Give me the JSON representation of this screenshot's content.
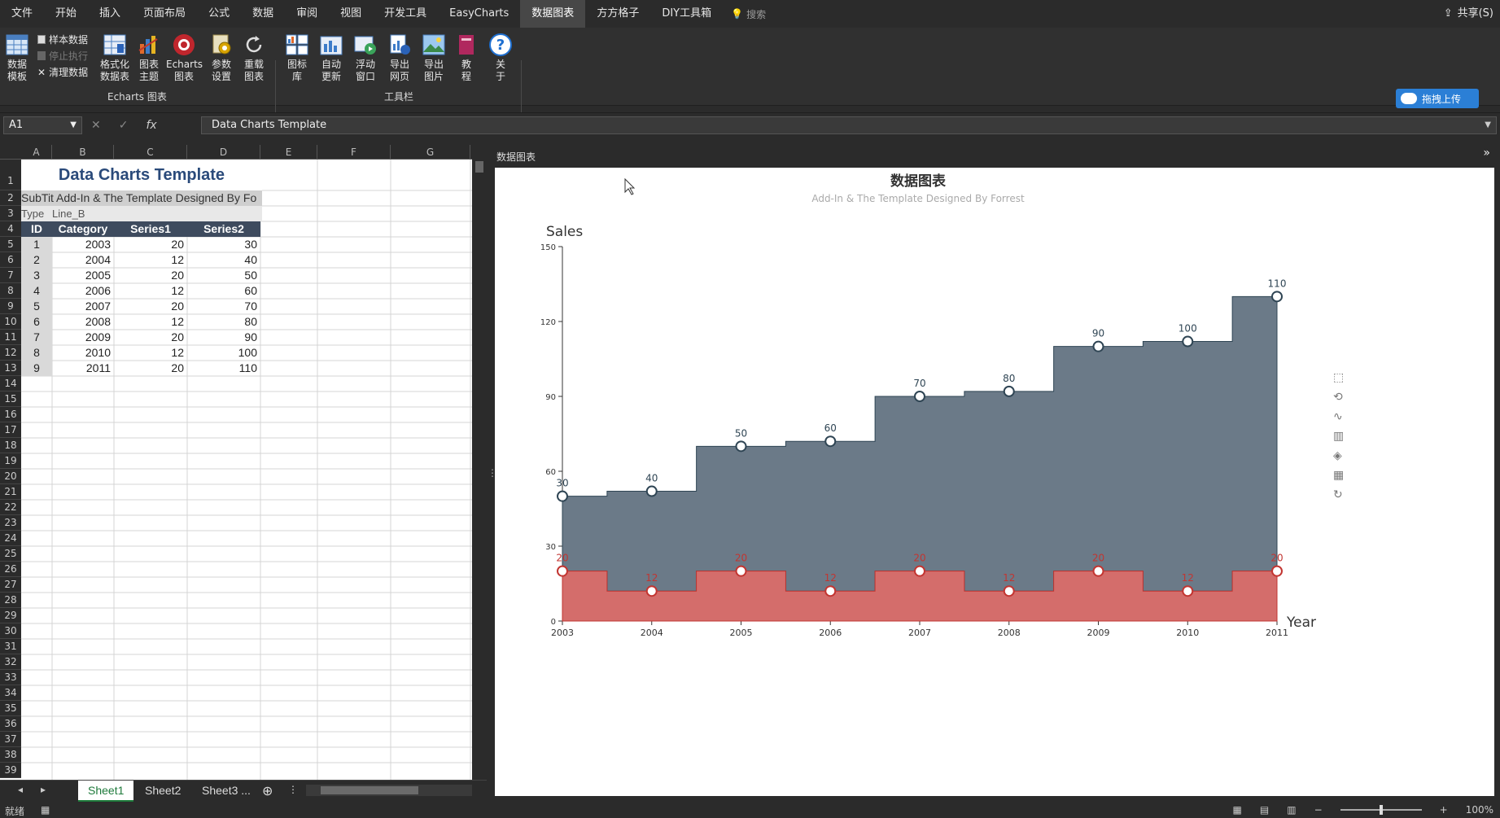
{
  "menu": {
    "items": [
      "文件",
      "开始",
      "插入",
      "页面布局",
      "公式",
      "数据",
      "审阅",
      "视图",
      "开发工具",
      "EasyCharts",
      "数据图表",
      "方方格子",
      "DIY工具箱"
    ],
    "active": "数据图表",
    "search_label": "搜索",
    "share_label": "共享(S)"
  },
  "ribbon": {
    "data_template": "数据模板",
    "sample_data": "样本数据",
    "stop_exec": "停止执行",
    "clear_data": "清理数据",
    "format_table": "格式化数据表",
    "chart_theme": "图表主题",
    "echarts_chart": "Echarts图表",
    "params": "参数设置",
    "reload": "重载图表",
    "group_echarts": "Echarts 图表",
    "gallery": "图标库",
    "auto_update": "自动更新",
    "float_window": "浮动窗口",
    "export_web": "导出网页",
    "export_img": "导出图片",
    "tutorial": "教程",
    "about": "关于",
    "group_toolbar": "工具栏",
    "upload": "拖拽上传"
  },
  "formula": {
    "namebox": "A1",
    "fx": "fx",
    "value": "Data Charts Template"
  },
  "sheet": {
    "columns": [
      "A",
      "B",
      "C",
      "D",
      "E",
      "F",
      "G"
    ],
    "rows": [
      "1",
      "2",
      "3",
      "4",
      "5",
      "6",
      "7",
      "8",
      "9",
      "10",
      "11",
      "12",
      "13",
      "14",
      "15",
      "16",
      "17",
      "18",
      "19",
      "20",
      "21",
      "22",
      "23",
      "24",
      "25",
      "26",
      "27",
      "28",
      "29",
      "30",
      "31",
      "32",
      "33",
      "34",
      "35",
      "36",
      "37",
      "38",
      "39"
    ],
    "title": "Data Charts Template",
    "subtitle_row": "SubTit Add-In & The Template Designed By Fo",
    "type_label": "Type",
    "type_value": "Line_B",
    "headers": [
      "ID",
      "Category",
      "Series1",
      "Series2"
    ],
    "data": [
      [
        "1",
        "2003",
        "20",
        "30"
      ],
      [
        "2",
        "2004",
        "12",
        "40"
      ],
      [
        "3",
        "2005",
        "20",
        "50"
      ],
      [
        "4",
        "2006",
        "12",
        "60"
      ],
      [
        "5",
        "2007",
        "20",
        "70"
      ],
      [
        "6",
        "2008",
        "12",
        "80"
      ],
      [
        "7",
        "2009",
        "20",
        "90"
      ],
      [
        "8",
        "2010",
        "12",
        "100"
      ],
      [
        "9",
        "2011",
        "20",
        "110"
      ]
    ],
    "tabs": [
      "Sheet1",
      "Sheet2",
      "Sheet3 ..."
    ],
    "active_tab": "Sheet1"
  },
  "pane": {
    "title": "数据图表"
  },
  "chart_data": {
    "type": "area",
    "step": true,
    "stacked": true,
    "title": "数据图表",
    "subtitle": "Add-In & The Template Designed By Forrest",
    "xlabel": "Year",
    "ylabel": "Sales",
    "ylim": [
      0,
      150
    ],
    "yticks": [
      0,
      30,
      60,
      90,
      120,
      150
    ],
    "categories": [
      "2003",
      "2004",
      "2005",
      "2006",
      "2007",
      "2008",
      "2009",
      "2010",
      "2011"
    ],
    "series": [
      {
        "name": "Series1",
        "values": [
          20,
          12,
          20,
          12,
          20,
          12,
          20,
          12,
          20
        ],
        "color": "#c23531"
      },
      {
        "name": "Series2",
        "values": [
          30,
          40,
          50,
          60,
          70,
          80,
          90,
          100,
          110
        ],
        "color": "#2f4554"
      }
    ]
  },
  "status": {
    "ready": "就绪",
    "zoom": "100%"
  },
  "colors": {
    "accent": "#2b7fd6",
    "series1": "#c23531",
    "series2": "#2f4554"
  }
}
